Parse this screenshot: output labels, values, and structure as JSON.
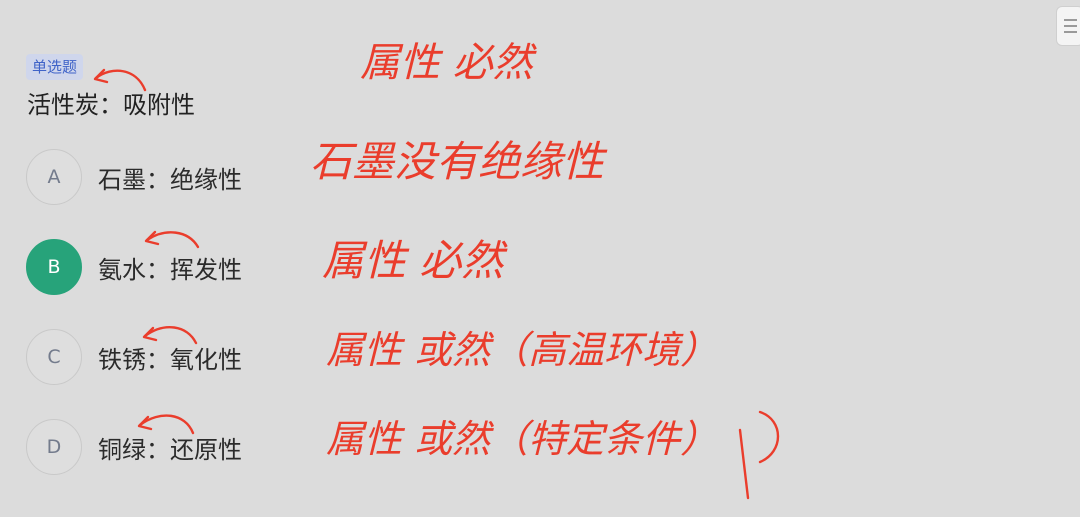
{
  "question": {
    "type_tag": "单选题",
    "stem": "活性炭：吸附性"
  },
  "options": [
    {
      "letter": "A",
      "text": "石墨：绝缘性",
      "selected": false
    },
    {
      "letter": "B",
      "text": "氨水：挥发性",
      "selected": true
    },
    {
      "letter": "C",
      "text": "铁锈：氧化性",
      "selected": false
    },
    {
      "letter": "D",
      "text": "铜绿：还原性",
      "selected": false
    }
  ],
  "annotations": {
    "stem_note": "属性 必然",
    "a_note": "石墨没有绝缘性",
    "b_note": "属性 必然",
    "c_note": "属性 或然（高温环境）",
    "d_note": "属性 或然（特定条件）"
  },
  "colors": {
    "selected": "#27a37a",
    "ink": "#ea3d2c",
    "tag_text": "#3f63c8",
    "tag_bg": "#cfd6ec"
  }
}
